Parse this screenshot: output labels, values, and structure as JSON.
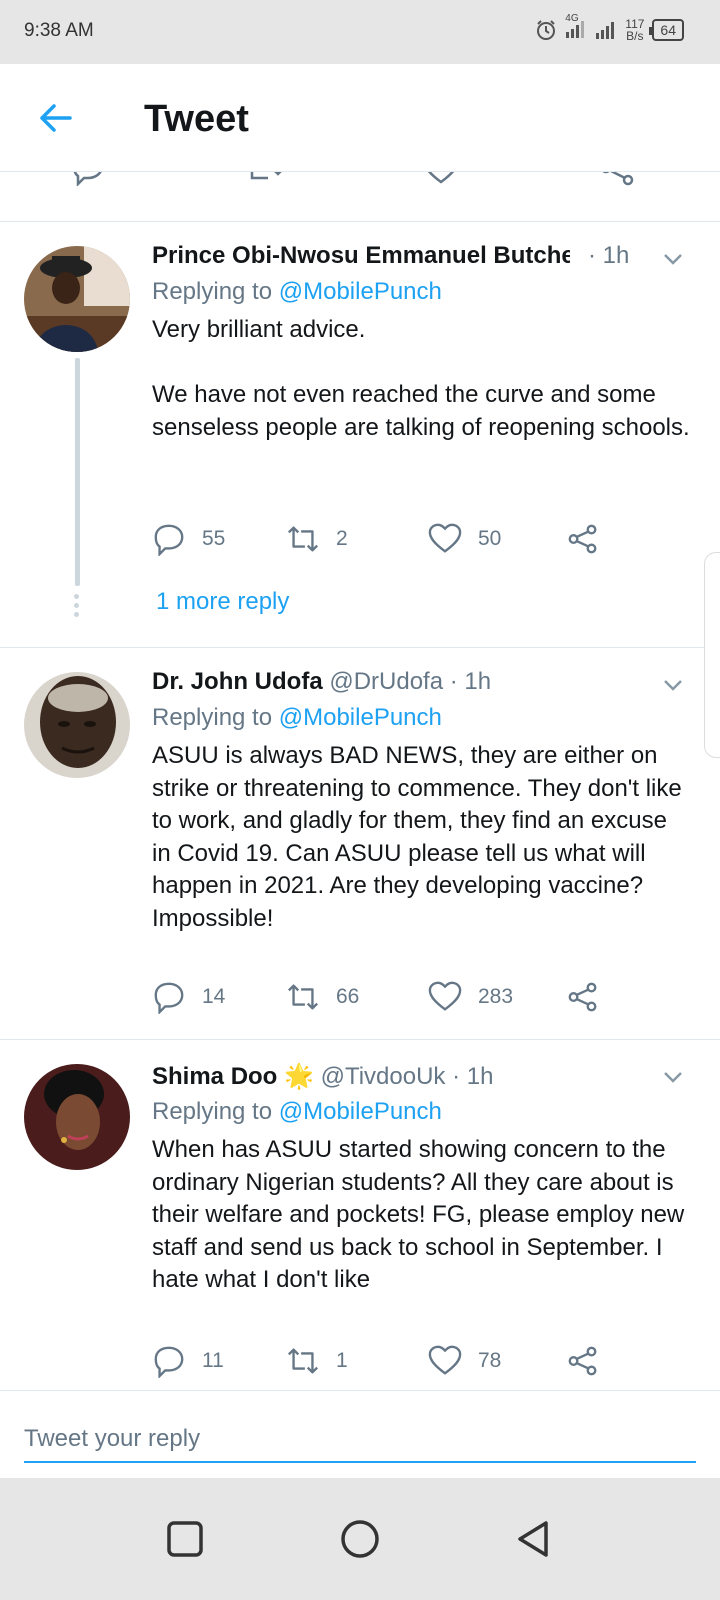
{
  "status_bar": {
    "time": "9:38 AM",
    "network": "4G",
    "speed_value": "117",
    "speed_unit": "B/s",
    "battery": "64"
  },
  "header": {
    "title": "Tweet",
    "back_icon": "arrow-left-icon"
  },
  "colors": {
    "accent": "#1da1f2",
    "secondary_text": "#657786",
    "divider": "#e1e8ed"
  },
  "tweets": [
    {
      "name": "Prince Obi-Nwosu Emmanuel  Butches",
      "handle": "...",
      "time": "· 1h",
      "replying_prefix": "Replying to",
      "replying_to": "@MobilePunch",
      "body": "Very brilliant advice.\n\nWe have not even reached the curve and some senseless people are talking of reopening schools.",
      "replies": "55",
      "retweets": "2",
      "likes": "50",
      "more_replies": "1 more reply"
    },
    {
      "name": "Dr. John Udofa",
      "handle": "@DrUdofa",
      "time": "· 1h",
      "replying_prefix": "Replying to",
      "replying_to": "@MobilePunch",
      "body": "ASUU is always BAD NEWS, they are either on strike or threatening to commence. They don't like to work, and gladly for them, they find an excuse in Covid 19. Can ASUU please tell us what will happen in 2021. Are they developing vaccine? Impossible!",
      "replies": "14",
      "retweets": "66",
      "likes": "283"
    },
    {
      "name": "Shima Doo",
      "emoji": "🌟",
      "handle": "@TivdooUk",
      "time": "· 1h",
      "replying_prefix": "Replying to",
      "replying_to": "@MobilePunch",
      "body": "When has ASUU started showing concern to the ordinary Nigerian students? All they care about is their welfare and pockets! FG, please employ new staff and send us back to school in September. I hate what I don't like",
      "replies": "11",
      "retweets": "1",
      "likes": "78"
    }
  ],
  "composer": {
    "placeholder": "Tweet your reply"
  },
  "nav_bar": {
    "buttons": [
      "recents-square-icon",
      "home-circle-icon",
      "back-triangle-icon"
    ]
  }
}
